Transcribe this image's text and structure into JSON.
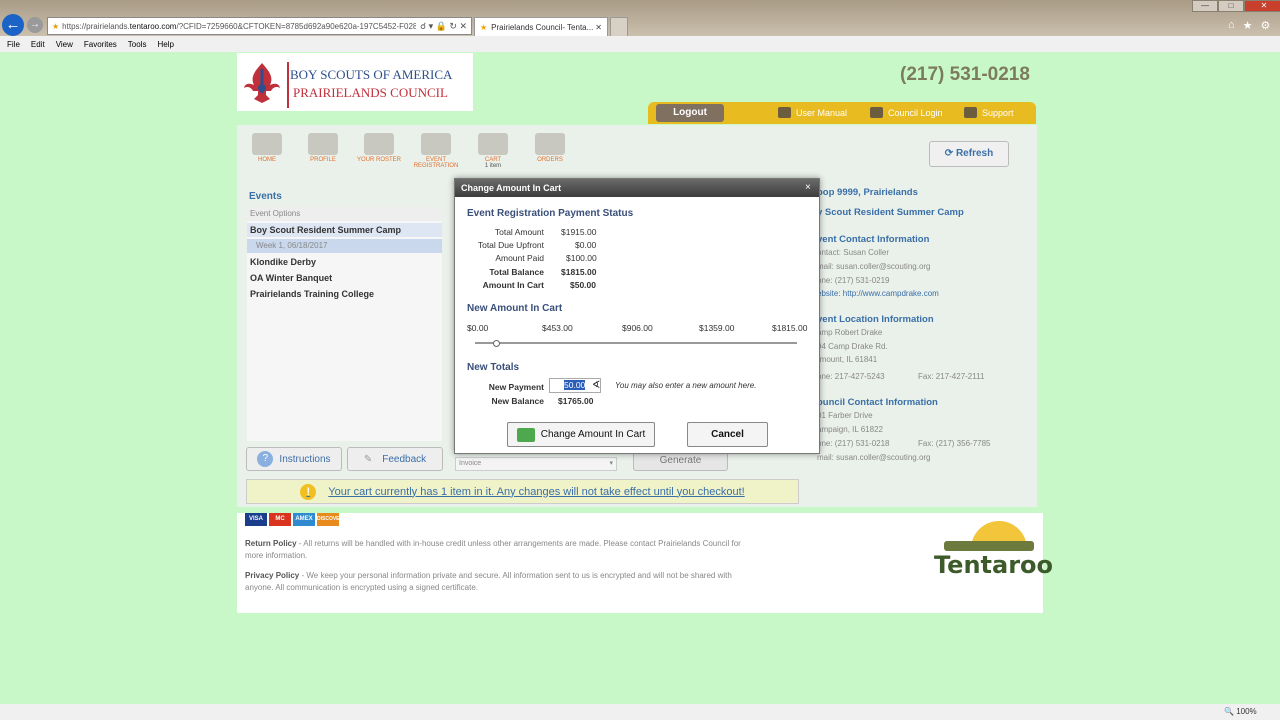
{
  "browser": {
    "url_prefix": "https://prairielands.",
    "url_domain": "tentaroo.com",
    "url_rest": "/?CFID=7259660&CFTOKEN=8785d692a90e620a-197C5452-F028",
    "tab_title": "Prairielands Council- Tenta..."
  },
  "menu": [
    "File",
    "Edit",
    "View",
    "Favorites",
    "Tools",
    "Help"
  ],
  "header": {
    "org_line1": "BOY SCOUTS OF AMERICA",
    "org_line2": "PRAIRIELANDS COUNCIL",
    "phone": "(217) 531-0218",
    "logout": "Logout",
    "user_manual": "User Manual",
    "council_login": "Council Login",
    "support": "Support"
  },
  "toolbar": {
    "items": [
      "HOME",
      "PROFILE",
      "YOUR ROSTER",
      "EVENT REGISTRATION",
      "CART",
      "ORDERS"
    ],
    "cart_count": "1 item",
    "refresh": "Refresh"
  },
  "events": {
    "title": "Events",
    "options_label": "Event Options",
    "items": [
      "Boy Scout Resident Summer Camp",
      "Week 1, 06/18/2017",
      "Klondike Derby",
      "OA Winter Banquet",
      "Prairielands Training College"
    ]
  },
  "actions": {
    "instructions": "Instructions",
    "feedback": "Feedback",
    "invoice": "Invoice",
    "generate": "Generate"
  },
  "cart_notice": "Your cart currently has 1 item in it. Any changes will not take effect until you checkout!",
  "right_info": {
    "troop": "oop 9999, Prairielands",
    "event": "y Scout Resident Summer Camp",
    "contact_title": "vent Contact Information",
    "contact_name": "ontact: Susan Coller",
    "contact_email": "mail: susan.coller@scouting.org",
    "contact_phone": "one: (217) 531-0219",
    "website": "ebsite: http://www.campdrake.com",
    "location_title": "vent Location Information",
    "location_name": "amp Robert Drake",
    "location_addr": "94 Camp Drake Rd.",
    "location_city": "rmount, IL 61841",
    "location_phone": "one: 217-427-5243",
    "location_fax": "Fax: 217-427-2111",
    "council_title": "ouncil Contact Information",
    "council_addr": "01 Farber Drive",
    "council_city": "ampaign, IL 61822",
    "council_phone": "one: (217) 531-0218",
    "council_fax": "Fax: (217) 356-7785",
    "council_email": "mail: susan.coller@scouting.org"
  },
  "modal": {
    "title": "Change Amount In Cart",
    "close": "×",
    "status_title": "Event Registration Payment Status",
    "rows": [
      {
        "label": "Total Amount",
        "value": "$1915.00"
      },
      {
        "label": "Total Due Upfront",
        "value": "$0.00"
      },
      {
        "label": "Amount Paid",
        "value": "$100.00"
      },
      {
        "label": "Total Balance",
        "value": "$1815.00"
      },
      {
        "label": "Amount In Cart",
        "value": "$50.00"
      }
    ],
    "amount_title": "New Amount In Cart",
    "ticks": [
      "$0.00",
      "$453.00",
      "$906.00",
      "$1359.00",
      "$1815.00"
    ],
    "slider": {
      "min": 0,
      "max": 1815,
      "value": 50
    },
    "totals_title": "New Totals",
    "new_payment_label": "New Payment",
    "new_payment_value": "50.00",
    "hint": "You may also enter a new amount here.",
    "new_balance_label": "New Balance",
    "new_balance_value": "$1765.00",
    "change_button": "Change Amount In Cart",
    "cancel_button": "Cancel"
  },
  "footer": {
    "cards": [
      "VISA",
      "MC",
      "AMEX",
      "DISCOVER"
    ],
    "return_label": "Return Policy",
    "return_text": " - All returns will be handled with in-house credit unless other arrangements are made. Please contact Prairielands Council for more information.",
    "privacy_label": "Privacy Policy",
    "privacy_text": " - We keep your personal information private and secure. All information sent to us is encrypted and will not be shared with anyone. All communication is encrypted using a signed certificate.",
    "brand": "Tentaroo"
  },
  "status": {
    "zoom": "100%"
  },
  "colors": {
    "page_bg": "#c8f8c8",
    "nav_bar": "#e8bc20",
    "link_blue": "#3a6fa8",
    "modal_header": "#4a4a4a"
  }
}
